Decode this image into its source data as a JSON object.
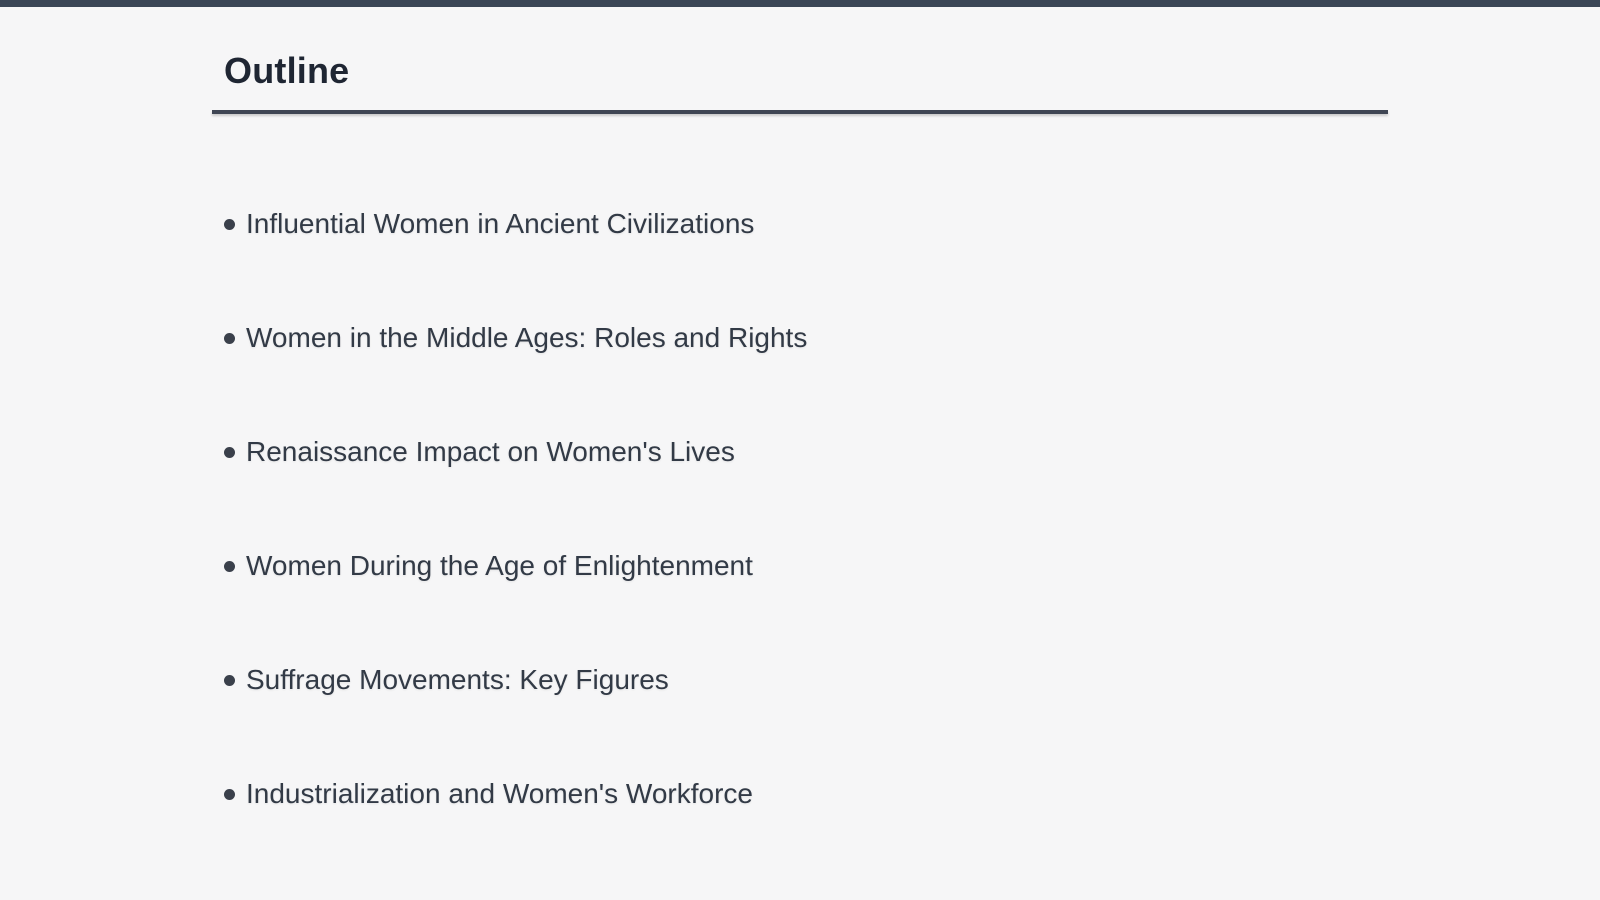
{
  "slide": {
    "title": "Outline",
    "items": [
      "Influential Women in Ancient Civilizations",
      "Women in the Middle Ages: Roles and Rights",
      "Renaissance Impact on Women's Lives",
      "Women During the Age of Enlightenment",
      "Suffrage Movements: Key Figures",
      "Industrialization and Women's Workforce"
    ]
  },
  "colors": {
    "background": "#f6f6f7",
    "top_bar": "#3b4656",
    "title": "#1f2633",
    "rule": "#3f4654",
    "text": "#323a46"
  }
}
